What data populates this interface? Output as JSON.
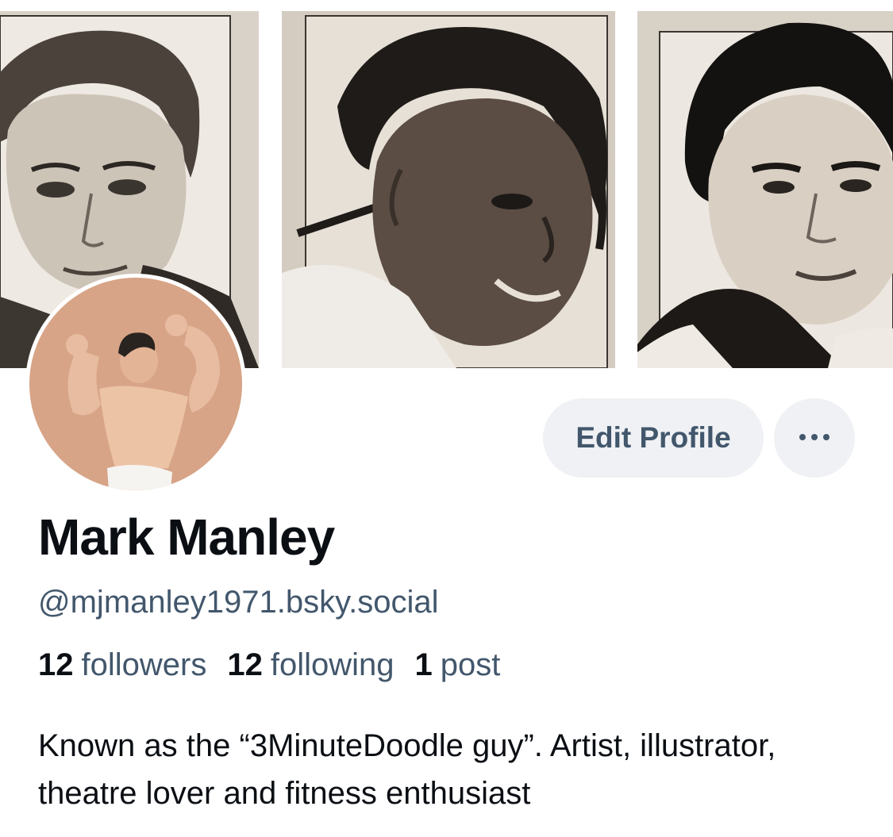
{
  "profile": {
    "display_name": "Mark Manley",
    "handle": "@mjmanley1971.bsky.social",
    "bio": "Known as the “3MinuteDoodle guy”. Artist, illustrator, theatre lover and fitness enthusiast"
  },
  "stats": {
    "followers_count": "12",
    "followers_label": "followers",
    "following_count": "12",
    "following_label": "following",
    "posts_count": "1",
    "posts_label": "post"
  },
  "actions": {
    "edit_profile_label": "Edit Profile",
    "more_icon": "more-horizontal-icon"
  },
  "colors": {
    "text_primary": "#0b0f14",
    "text_secondary": "#42576c",
    "button_bg": "#eff1f4"
  }
}
